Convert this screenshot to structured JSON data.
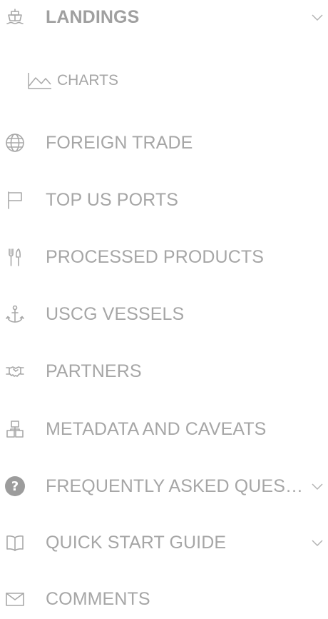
{
  "nav": {
    "landings": {
      "label": "LANDINGS",
      "icon": "ship-icon",
      "expanded": true
    },
    "charts": {
      "label": "CHARTS",
      "icon": "line-chart-icon"
    },
    "foreign_trade": {
      "label": "FOREIGN TRADE",
      "icon": "globe-icon"
    },
    "top_us_ports": {
      "label": "TOP US PORTS",
      "icon": "flag-icon"
    },
    "processed_products": {
      "label": "PROCESSED PRODUCTS",
      "icon": "utensils-icon"
    },
    "uscg_vessels": {
      "label": "USCG VESSELS",
      "icon": "anchor-icon"
    },
    "partners": {
      "label": "PARTNERS",
      "icon": "handshake-icon"
    },
    "metadata": {
      "label": "METADATA AND CAVEATS",
      "icon": "cluster-icon"
    },
    "faq": {
      "label": "FREQUENTLY ASKED QUESTIONS",
      "icon": "question-circle-icon"
    },
    "quick_start": {
      "label": "QUICK START GUIDE",
      "icon": "book-icon"
    },
    "comments": {
      "label": "COMMENTS",
      "icon": "envelope-icon"
    }
  },
  "colors": {
    "text": "#a6a6a6",
    "icon": "#a8a8a8",
    "background": "#ffffff"
  }
}
